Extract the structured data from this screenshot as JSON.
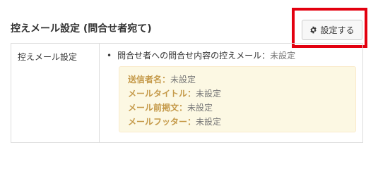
{
  "header": {
    "title": "控えメール設定 (問合せ者宛て)",
    "settings_button_label": "設定する",
    "settings_icon": "gear-icon",
    "highlight_color": "#e3000f"
  },
  "table": {
    "label": "控えメール設定",
    "bullet_text": "問合せ者への問合せ内容の控えメール：",
    "bullet_status": "未設定",
    "details": [
      {
        "key": "送信者名：",
        "value": "未設定"
      },
      {
        "key": "メールタイトル：",
        "value": "未設定"
      },
      {
        "key": "メール前掲文：",
        "value": "未設定"
      },
      {
        "key": "メールフッター：",
        "value": "未設定"
      }
    ]
  }
}
